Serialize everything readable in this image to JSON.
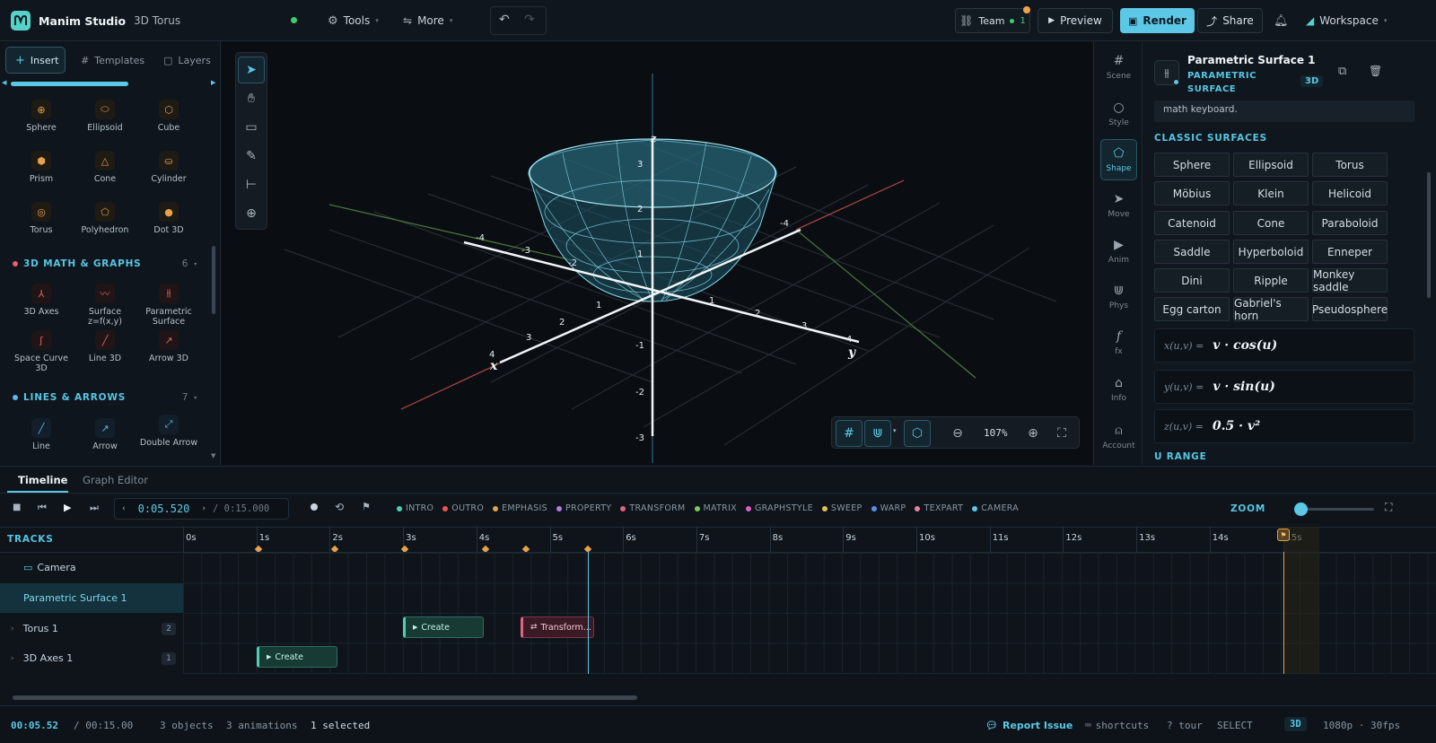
{
  "app": {
    "name": "Manim Studio",
    "project": "3D Torus"
  },
  "topbar": {
    "tools_label": "Tools",
    "more_label": "More",
    "team_label": "Team",
    "team_count": "1",
    "preview_label": "Preview",
    "render_label": "Render",
    "share_label": "Share",
    "workspace_label": "Workspace"
  },
  "left": {
    "tabs": [
      {
        "label": "Insert"
      },
      {
        "label": "Templates"
      },
      {
        "label": "Layers"
      }
    ],
    "shapes_3d": [
      {
        "label": "Sphere"
      },
      {
        "label": "Ellipsoid"
      },
      {
        "label": "Cube"
      },
      {
        "label": "Prism"
      },
      {
        "label": "Cone"
      },
      {
        "label": "Cylinder"
      },
      {
        "label": "Torus"
      },
      {
        "label": "Polyhedron"
      },
      {
        "label": "Dot 3D"
      }
    ],
    "math_section": {
      "title": "3D MATH & GRAPHS",
      "count": "6"
    },
    "math_items": [
      {
        "label": "3D Axes"
      },
      {
        "label": "Surface z=f(x,y)"
      },
      {
        "label": "Parametric Surface"
      },
      {
        "label": "Space Curve 3D"
      },
      {
        "label": "Line 3D"
      },
      {
        "label": "Arrow 3D"
      }
    ],
    "lines_section": {
      "title": "LINES & ARROWS",
      "count": "7"
    },
    "line_items": [
      {
        "label": "Line"
      },
      {
        "label": "Arrow"
      },
      {
        "label": "Double Arrow"
      }
    ]
  },
  "viewport": {
    "zoom": "107%",
    "axis_labels": {
      "x": "x",
      "y": "y",
      "z": "z"
    },
    "x_ticks": [
      "-4",
      "-3",
      "-2",
      "1",
      "2",
      "3",
      "4"
    ],
    "y_ticks": [
      "-4",
      "1",
      "2",
      "3",
      "4"
    ],
    "z_ticks": [
      "1",
      "2",
      "3",
      "-1",
      "-2",
      "-3"
    ]
  },
  "rail": [
    {
      "label": "Scene",
      "icon": "grid-icon"
    },
    {
      "label": "Style",
      "icon": "circle-icon"
    },
    {
      "label": "Shape",
      "icon": "pentagon-icon"
    },
    {
      "label": "Move",
      "icon": "cursor-icon"
    },
    {
      "label": "Anim",
      "icon": "play-icon"
    },
    {
      "label": "Phys",
      "icon": "magnet-icon"
    },
    {
      "label": "fx",
      "icon": "fx-icon"
    },
    {
      "label": "Info",
      "icon": "info-icon"
    },
    {
      "label": "Account",
      "icon": "user-icon"
    }
  ],
  "inspector": {
    "title": "Parametric Surface 1",
    "subtitle": "PARAMETRIC SURFACE",
    "badge": "3D",
    "hint_tail": "math keyboard.",
    "classic_title": "CLASSIC SURFACES",
    "surfaces": [
      "Sphere",
      "Ellipsoid",
      "Torus",
      "Möbius",
      "Klein",
      "Helicoid",
      "Catenoid",
      "Cone",
      "Paraboloid",
      "Saddle",
      "Hyperboloid",
      "Enneper",
      "Dini",
      "Ripple",
      "Monkey saddle",
      "Egg carton",
      "Gabriel's horn",
      "Pseudosphere"
    ],
    "formulas": [
      {
        "lhs": "x(u,v) =",
        "rhs": "v · cos(u)"
      },
      {
        "lhs": "y(u,v) =",
        "rhs": "v · sin(u)"
      },
      {
        "lhs": "z(u,v) =",
        "rhs": "0.5 · v²"
      }
    ],
    "u_range_title": "U RANGE"
  },
  "timeline": {
    "tabs": [
      {
        "label": "Timeline"
      },
      {
        "label": "Graph Editor"
      }
    ],
    "current_time": "0:05.520",
    "total_time": "/ 0:15.000",
    "legend": [
      {
        "label": "INTRO",
        "color": "#4bd1b0"
      },
      {
        "label": "OUTRO",
        "color": "#e8574f"
      },
      {
        "label": "EMPHASIS",
        "color": "#e5a24b"
      },
      {
        "label": "PROPERTY",
        "color": "#b07fe0"
      },
      {
        "label": "TRANSFORM",
        "color": "#e26482"
      },
      {
        "label": "MATRIX",
        "color": "#7cc95a"
      },
      {
        "label": "GRAPHSTYLE",
        "color": "#d85fc8"
      },
      {
        "label": "SWEEP",
        "color": "#e5c34b"
      },
      {
        "label": "WARP",
        "color": "#5c8fe6"
      },
      {
        "label": "TEXPART",
        "color": "#e880a8"
      },
      {
        "label": "CAMERA",
        "color": "#5cc8e6"
      }
    ],
    "zoom_label": "ZOOM",
    "tracks_label": "TRACKS",
    "ruler": [
      "0s",
      "1s",
      "2s",
      "3s",
      "4s",
      "5s",
      "6s",
      "7s",
      "8s",
      "9s",
      "10s",
      "11s",
      "12s",
      "13s",
      "14s",
      "15s"
    ],
    "tracks": [
      {
        "label": "Camera",
        "count": ""
      },
      {
        "label": "Parametric Surface 1",
        "count": ""
      },
      {
        "label": "Torus 1",
        "count": "2"
      },
      {
        "label": "3D Axes 1",
        "count": "1"
      }
    ],
    "clips": [
      {
        "label": "Create"
      },
      {
        "label": "Transform..."
      },
      {
        "label": "Create"
      }
    ]
  },
  "status": {
    "time": "00:05.52",
    "total": "/ 00:15.00",
    "objects": "3 objects",
    "animations": "3 animations",
    "selected": "1 selected",
    "report": "Report Issue",
    "shortcuts": "shortcuts",
    "tour": "? tour",
    "mode": "SELECT",
    "dim": "3D",
    "resolution": "1080p · 30fps"
  }
}
